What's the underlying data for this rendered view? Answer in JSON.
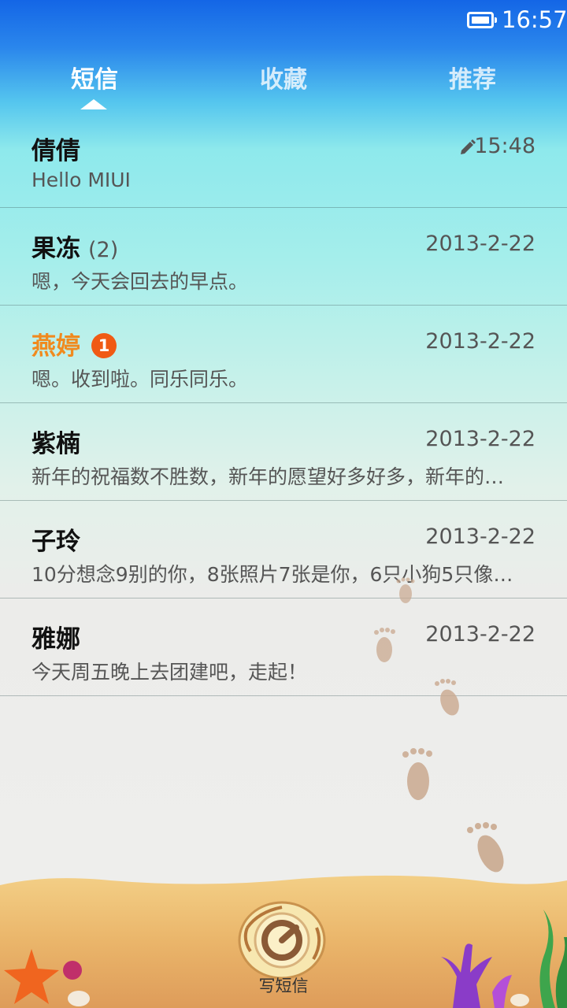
{
  "status_bar": {
    "time": "16:57"
  },
  "tabs": [
    {
      "label": "短信",
      "active": true
    },
    {
      "label": "收藏",
      "active": false
    },
    {
      "label": "推荐",
      "active": false
    }
  ],
  "threads": [
    {
      "name": "倩倩",
      "count": "",
      "badge": "",
      "preview": "Hello MIUI",
      "time": "15:48",
      "draft": true,
      "unread": false
    },
    {
      "name": "果冻",
      "count": "(2)",
      "badge": "",
      "preview": "嗯，今天会回去的早点。",
      "time": "2013-2-22",
      "draft": false,
      "unread": false
    },
    {
      "name": "燕婷",
      "count": "",
      "badge": "1",
      "preview": "嗯。收到啦。同乐同乐。",
      "time": "2013-2-22",
      "draft": false,
      "unread": true
    },
    {
      "name": "紫楠",
      "count": "",
      "badge": "",
      "preview": "新年的祝福数不胜数，新年的愿望好多好多，新年的…",
      "time": "2013-2-22",
      "draft": false,
      "unread": false
    },
    {
      "name": "子玲",
      "count": "",
      "badge": "",
      "preview": "10分想念9别的你，8张照片7张是你，6只小狗5只像…",
      "time": "2013-2-22",
      "draft": false,
      "unread": false
    },
    {
      "name": "雅娜",
      "count": "",
      "badge": "",
      "preview": "今天周五晚上去团建吧，走起！",
      "time": "2013-2-22",
      "draft": false,
      "unread": false
    }
  ],
  "compose": {
    "label": "写短信",
    "icon": "shell-compose-icon"
  },
  "colors": {
    "unread_name": "#f08a1e",
    "badge": "#f05a14"
  }
}
